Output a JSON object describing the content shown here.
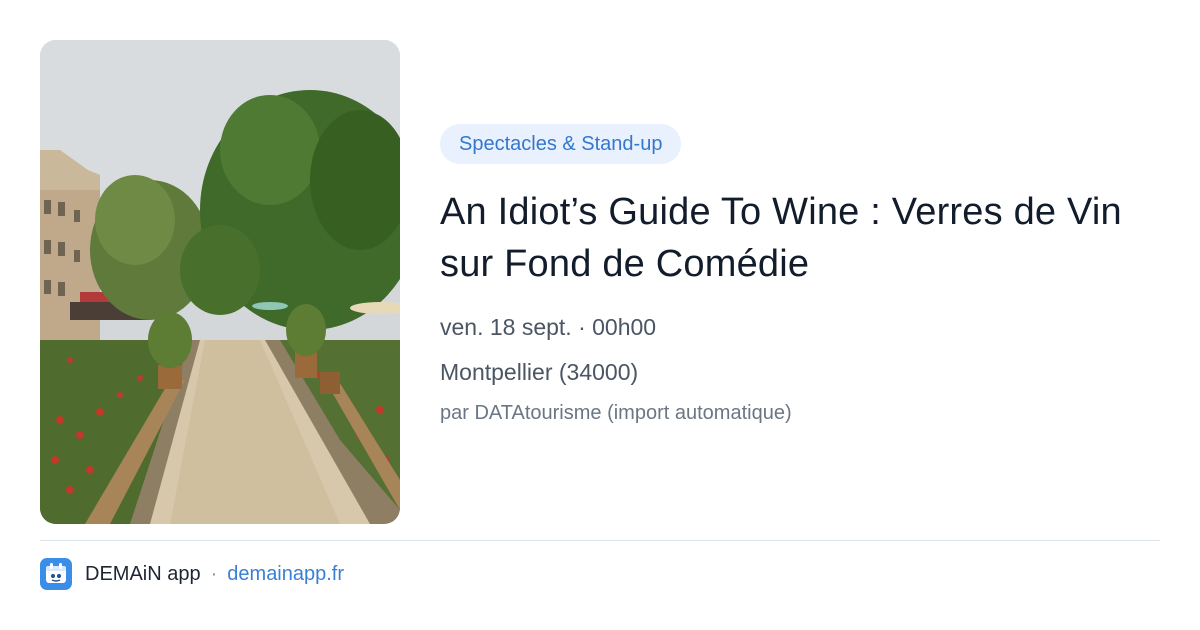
{
  "card": {
    "category_tag": "Spectacles & Stand-up",
    "title": "An Idiot’s Guide To Wine : Verres de Vin sur Fond de Comédie",
    "date_time": "ven. 18 sept. · 00h00",
    "location": "Montpellier (34000)",
    "author": "par DATAtourisme (import automatique)"
  },
  "footer": {
    "app_icon": "demain-app-logo-icon",
    "app_name": "DEMAiN app",
    "separator": "·",
    "site": "demainapp.fr"
  },
  "colors": {
    "accent": "#3577cc",
    "tag_background": "#e8f1fd",
    "app_icon_background": "#3b8ee8",
    "title_text": "#131c2b",
    "meta_text": "#4c5563"
  }
}
